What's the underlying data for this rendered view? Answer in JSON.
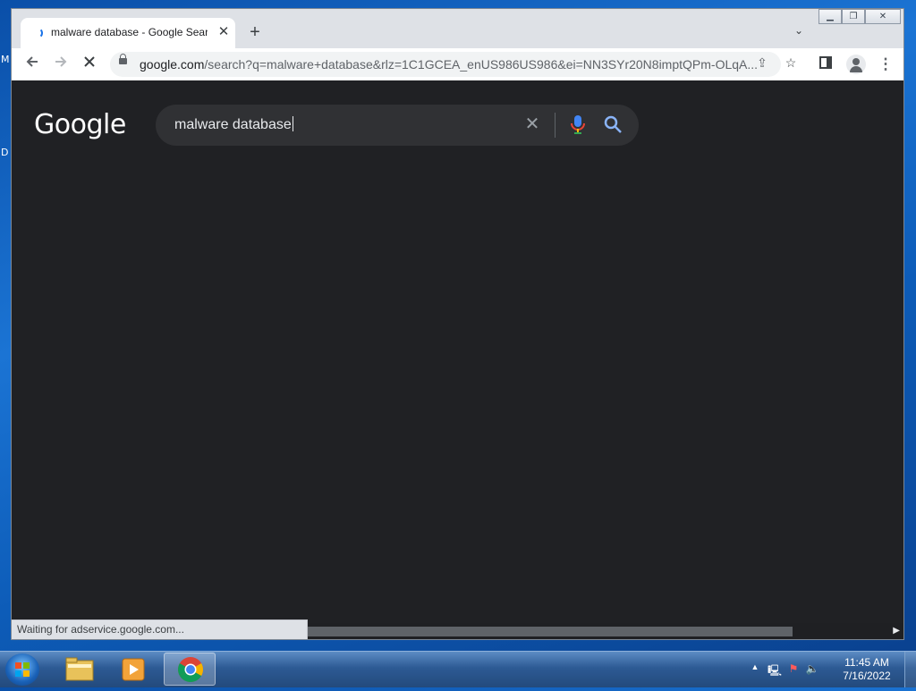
{
  "desktop": {
    "fragments": [
      "M",
      "D"
    ]
  },
  "browser": {
    "tab": {
      "title": "malware database - Google Search",
      "close_label": "✕"
    },
    "new_tab_label": "+",
    "url": {
      "host": "google.com",
      "rest": "/search?q=malware+database&rlz=1C1GCEA_enUS986US986&ei=NN3SYr20N8imptQPm-OLqA..."
    },
    "status_text": "Waiting for adservice.google.com..."
  },
  "google": {
    "logo": "Google",
    "query": "malware database"
  },
  "taskbar": {
    "time": "11:45 AM",
    "date": "7/16/2022"
  },
  "colors": {
    "accent": "#1a73e8",
    "page_bg": "#202124",
    "searchbox_bg": "#303134"
  }
}
